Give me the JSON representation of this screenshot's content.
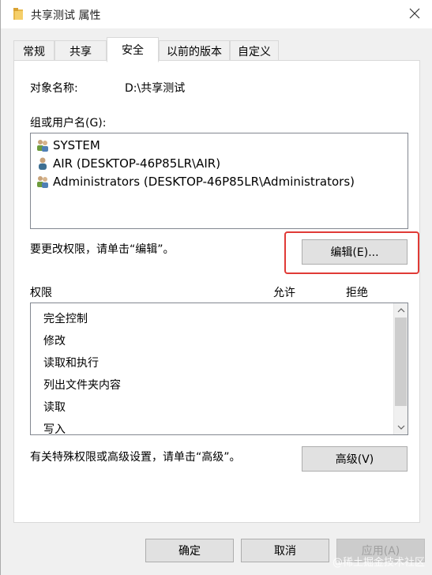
{
  "window": {
    "title": "共享测试 属性",
    "folder_icon": "folder-icon",
    "close_icon": "close-icon"
  },
  "tabs": [
    {
      "label": "常规",
      "active": false
    },
    {
      "label": "共享",
      "active": false
    },
    {
      "label": "安全",
      "active": true
    },
    {
      "label": "以前的版本",
      "active": false
    },
    {
      "label": "自定义",
      "active": false
    }
  ],
  "security": {
    "object_name_label": "对象名称:",
    "object_name_value": "D:\\共享测试",
    "groups_label": "组或用户名(G):",
    "users": [
      {
        "name": "SYSTEM",
        "icon": "group-users-icon"
      },
      {
        "name": "AIR (DESKTOP-46P85LR\\AIR)",
        "icon": "single-user-icon"
      },
      {
        "name": "Administrators (DESKTOP-46P85LR\\Administrators)",
        "icon": "group-users-icon"
      }
    ],
    "change_hint": "要更改权限，请单击“编辑”。",
    "edit_button": "编辑(E)...",
    "permissions_label": "权限",
    "allow_label": "允许",
    "deny_label": "拒绝",
    "permissions": [
      "完全控制",
      "修改",
      "读取和执行",
      "列出文件夹内容",
      "读取",
      "写入"
    ],
    "advanced_hint": "有关特殊权限或高级设置，请单击“高级”。",
    "advanced_button": "高级(V)"
  },
  "footer": {
    "ok_button": "确定",
    "cancel_button": "取消",
    "apply_button": "应用(A)",
    "watermark": "@稀土掘金技术社区"
  },
  "colors": {
    "highlight": "#e03a36",
    "window_bg": "#f0f0f0"
  }
}
